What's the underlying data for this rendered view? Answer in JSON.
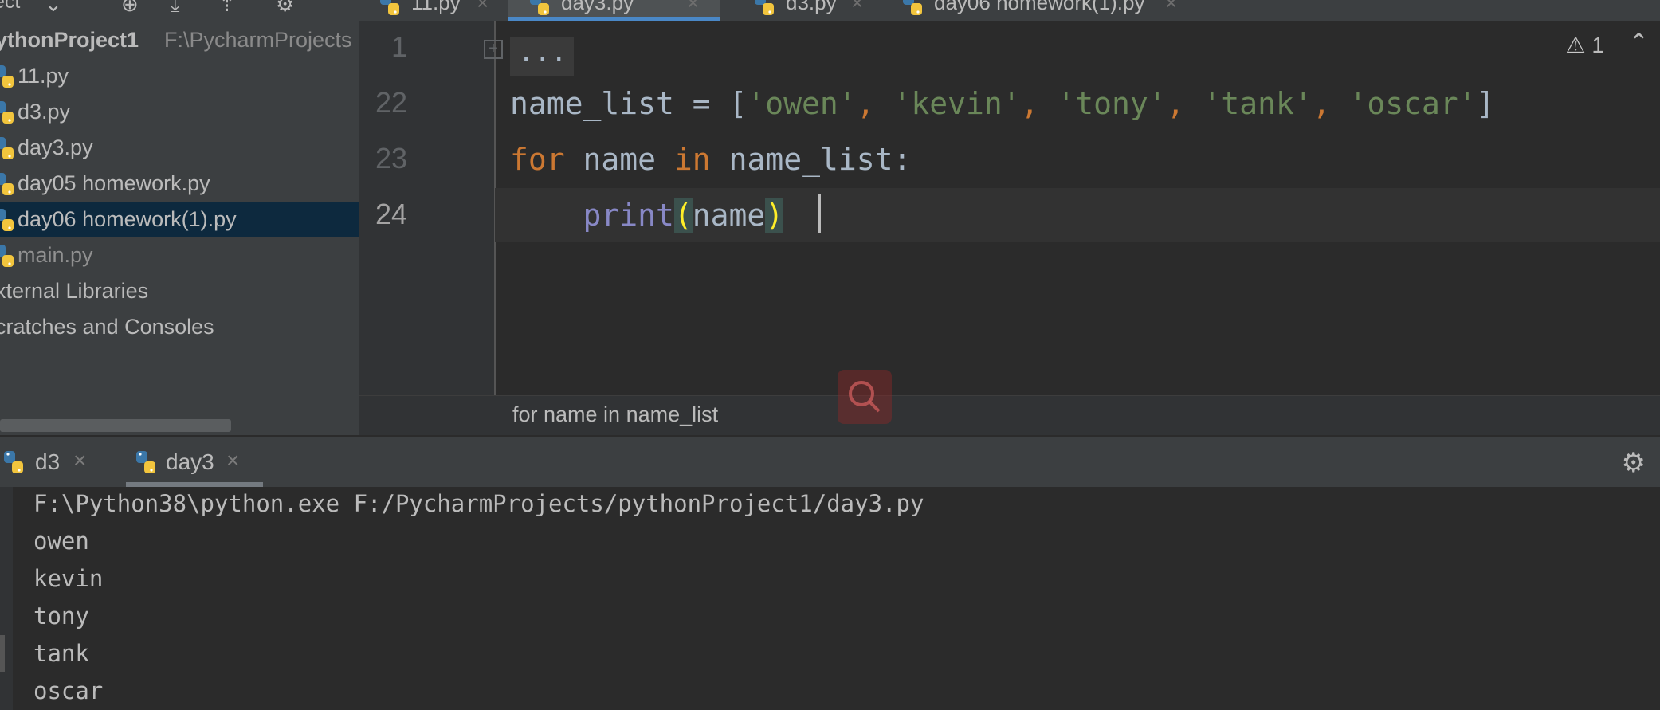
{
  "project_panel": {
    "header_label": "ect",
    "root_name": "ythonProject1",
    "root_path": "F:\\PycharmProjects",
    "files": [
      {
        "name": "11.py",
        "selected": false
      },
      {
        "name": "d3.py",
        "selected": false
      },
      {
        "name": "day3.py",
        "selected": false
      },
      {
        "name": "day05 homework.py",
        "selected": false
      },
      {
        "name": "day06 homework(1).py",
        "selected": true
      },
      {
        "name": "main.py",
        "selected": false
      }
    ],
    "external_libraries": "xternal Libraries",
    "scratches": "cratches and Consoles"
  },
  "editor_tabs": [
    {
      "label": "11.py",
      "active": false
    },
    {
      "label": "day3.py",
      "active": true
    },
    {
      "label": "d3.py",
      "active": false
    },
    {
      "label": "day06 homework(1).py",
      "active": false
    }
  ],
  "editor": {
    "line_numbers": [
      "1",
      "22",
      "23",
      "24"
    ],
    "fold_placeholder": "...",
    "line22": {
      "var": "name_list",
      "eq": " = [",
      "items": [
        "'owen'",
        "'kevin'",
        "'tony'",
        "'tank'",
        "'oscar'"
      ],
      "close": "]"
    },
    "line23": {
      "kw_for": "for",
      "var": " name ",
      "kw_in": "in",
      "rest": " name_list:"
    },
    "line24": {
      "indent": "    ",
      "func": "print",
      "open": "(",
      "arg": "name",
      "close": ")"
    },
    "warnings_count": "1",
    "breadcrumb": "for name in name_list"
  },
  "run_panel": {
    "tabs": [
      {
        "label": "d3",
        "active": false
      },
      {
        "label": "day3",
        "active": true
      }
    ],
    "output": [
      "F:\\Python38\\python.exe F:/PycharmProjects/pythonProject1/day3.py",
      "owen",
      "kevin",
      "tony",
      "tank",
      "oscar"
    ]
  },
  "colors": {
    "selection": "#0d293e",
    "active_tab_underline": "#4a88c7",
    "keyword": "#cc7832",
    "string": "#6a8759",
    "builtin": "#8888c6"
  }
}
